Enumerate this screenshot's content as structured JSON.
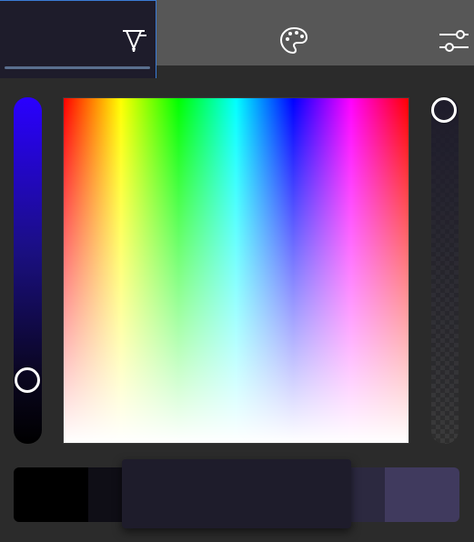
{
  "tabs": [
    {
      "id": "picker",
      "icon": "color-picker-icon",
      "active": true
    },
    {
      "id": "palette",
      "icon": "palette-icon",
      "active": false
    },
    {
      "id": "settings",
      "icon": "sliders-icon",
      "active": false
    }
  ],
  "brightness_slider": {
    "value": 0.16,
    "color_top": "#2a00ff"
  },
  "spectrum": {
    "type": "hue-saturation"
  },
  "alpha_slider": {
    "value": 1.0
  },
  "colors": {
    "current": "#1e1c2b",
    "accent": "#3a7bd5"
  },
  "swatches": [
    "#000000",
    "#0f0e16",
    "#1e1c2b",
    "#1e1c2b",
    "#2c2940",
    "#403a5e"
  ],
  "preview_color": "#1e1c2b"
}
